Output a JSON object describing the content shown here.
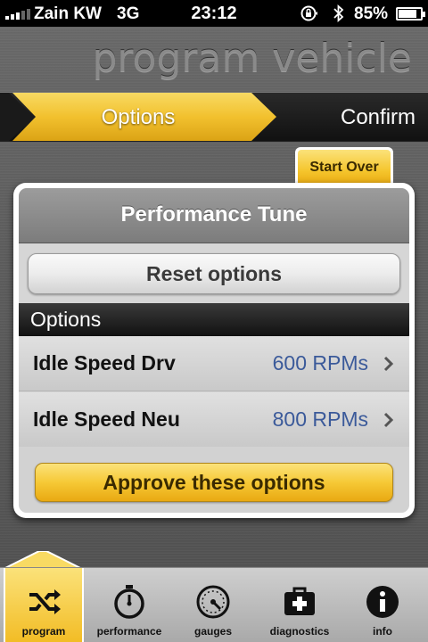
{
  "status_bar": {
    "carrier": "Zain KW",
    "network": "3G",
    "time": "23:12",
    "battery_percent_text": "85%",
    "battery_level": 0.85,
    "signal_bars": 3
  },
  "header": {
    "title": "program vehicle"
  },
  "steps": {
    "active_label": "Options",
    "next_label": "Confirm"
  },
  "start_over_label": "Start Over",
  "dialog": {
    "title": "Performance Tune",
    "reset_label": "Reset options",
    "section_label": "Options",
    "options": [
      {
        "label": "Idle Speed Drv",
        "value": "600 RPMs"
      },
      {
        "label": "Idle Speed Neu",
        "value": "800 RPMs"
      }
    ],
    "approve_label": "Approve these options"
  },
  "tabs": [
    {
      "label": "program",
      "icon": "shuffle-icon",
      "active": true
    },
    {
      "label": "performance",
      "icon": "stopwatch-icon",
      "active": false
    },
    {
      "label": "gauges",
      "icon": "gauge-icon",
      "active": false
    },
    {
      "label": "diagnostics",
      "icon": "medical-kit-icon",
      "active": false
    },
    {
      "label": "info",
      "icon": "info-icon",
      "active": false
    }
  ],
  "colors": {
    "accent_yellow": "#f5c52c",
    "value_blue": "#3b5a9a"
  }
}
